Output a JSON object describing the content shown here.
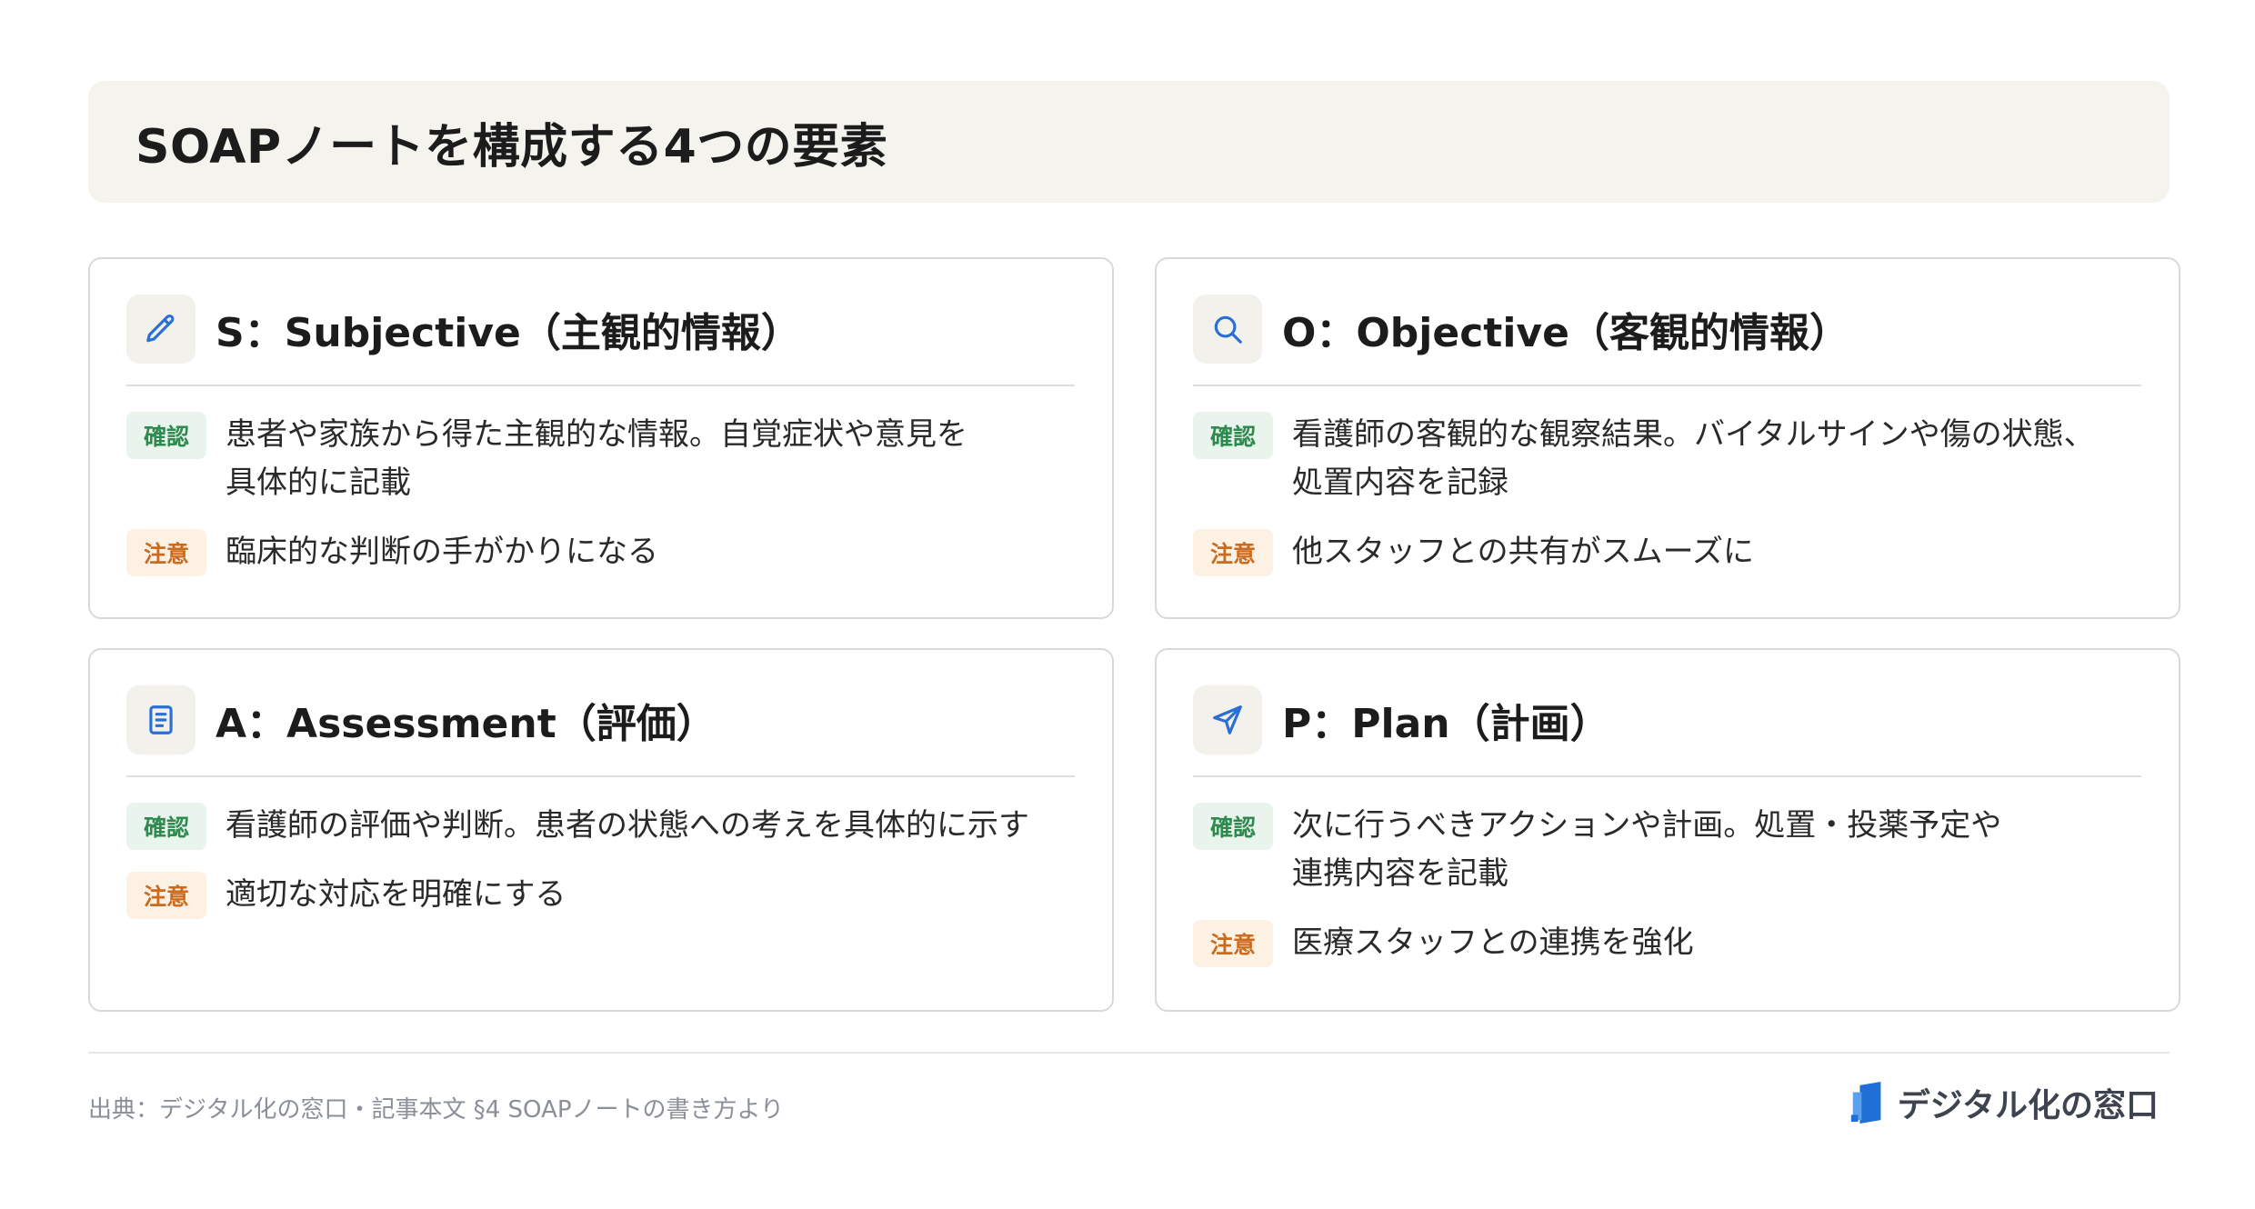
{
  "page": {
    "title": "SOAPノートを構成する4つの要素"
  },
  "badges": {
    "check": "確認",
    "note": "注意"
  },
  "cards": [
    {
      "icon": "pencil-icon",
      "title": "S：Subjective（主観的情報）",
      "check_text": "患者や家族から得た主観的な情報。自覚症状や意見を\n具体的に記載",
      "note_text": "臨床的な判断の手がかりになる"
    },
    {
      "icon": "search-icon",
      "title": "O：Objective（客観的情報）",
      "check_text": "看護師の客観的な観察結果。バイタルサインや傷の状態、\n処置内容を記録",
      "note_text": "他スタッフとの共有がスムーズに"
    },
    {
      "icon": "document-icon",
      "title": "A：Assessment（評価）",
      "check_text": "看護師の評価や判断。患者の状態への考えを具体的に示す",
      "note_text": "適切な対応を明確にする"
    },
    {
      "icon": "send-icon",
      "title": "P：Plan（計画）",
      "check_text": "次に行うべきアクションや計画。処置・投薬予定や\n連携内容を記載",
      "note_text": "医療スタッフとの連携を強化"
    }
  ],
  "footer": {
    "source": "出典：デジタル化の窓口・記事本文 §4 SOAPノートの書き方より",
    "brand": "デジタル化の窓口"
  },
  "colors": {
    "icon_blue": "#2b6fd4",
    "check_green": "#2e8a4e",
    "note_orange": "#cc6a1d",
    "title_bg": "#f5f3ee"
  }
}
